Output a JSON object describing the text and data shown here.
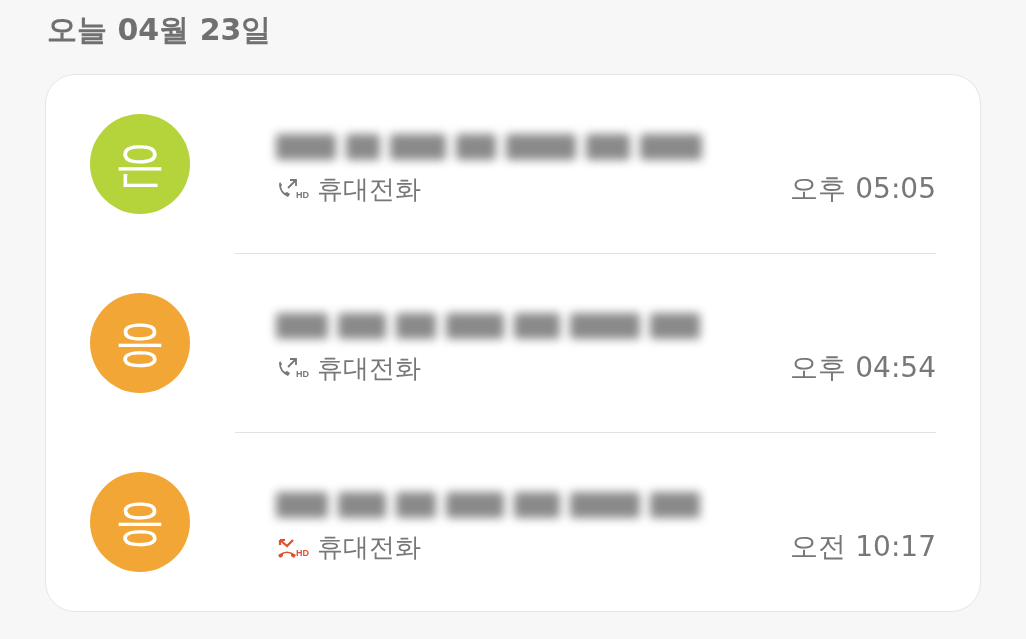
{
  "date_header": "오늘 04월 23일",
  "calls": [
    {
      "avatar": "은",
      "color": "#b5d33a",
      "kind": "outgoing",
      "hd": "HD",
      "number_type": "휴대전화",
      "time": "오후 05:05"
    },
    {
      "avatar": "응",
      "color": "#f2a636",
      "kind": "outgoing",
      "hd": "HD",
      "number_type": "휴대전화",
      "time": "오후 04:54"
    },
    {
      "avatar": "응",
      "color": "#f2a636",
      "kind": "missed",
      "hd": "HD",
      "number_type": "휴대전화",
      "time": "오전 10:17"
    }
  ]
}
